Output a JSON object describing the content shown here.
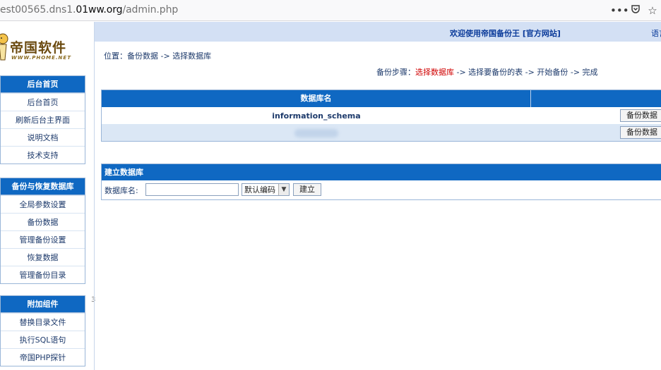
{
  "browser": {
    "url_prefix": "est00565.dns1.",
    "url_host": "01ww.org",
    "url_suffix": "/admin.php",
    "icons": [
      "more-icon",
      "pocket-icon",
      "star-icon"
    ]
  },
  "logo": {
    "cn": "帝国软件",
    "en": "WWW.PHOME.NET"
  },
  "sidebar": {
    "menus": [
      {
        "title": "后台首页",
        "items": [
          "后台首页",
          "刷新后台主界面",
          "说明文档",
          "技术支持"
        ]
      },
      {
        "title": "备份与恢复数据库",
        "items": [
          "全局参数设置",
          "备份数据",
          "管理备份设置",
          "恢复数据",
          "管理备份目录"
        ]
      },
      {
        "title": "附加组件",
        "items": [
          "替换目录文件",
          "执行SQL语句",
          "帝国PHP探针"
        ]
      }
    ],
    "divider_mark": "3"
  },
  "header": {
    "welcome": "欢迎使用帝国备份王 [官方网站]",
    "lang": "语言"
  },
  "breadcrumb": {
    "label": "位置：",
    "items": [
      "备份数据",
      "选择数据库"
    ],
    "sep": " -> "
  },
  "steps": {
    "label": "备份步骤：",
    "current": "选择数据库",
    "rest": " -> 选择要备份的表 -> 开始备份 -> 完成"
  },
  "db_table": {
    "headers": [
      "数据库名",
      ""
    ],
    "rows": [
      {
        "name": "information_schema",
        "action": "备份数据"
      },
      {
        "name": "",
        "action": "备份数据"
      }
    ]
  },
  "create_db": {
    "title": "建立数据库",
    "label": "数据库名:",
    "input_value": "",
    "encoding": "默认编码",
    "button": "建立"
  },
  "colors": {
    "header_blue": "#0f68c2",
    "topbar": "#d3e0f4",
    "current_step": "#d00000"
  }
}
